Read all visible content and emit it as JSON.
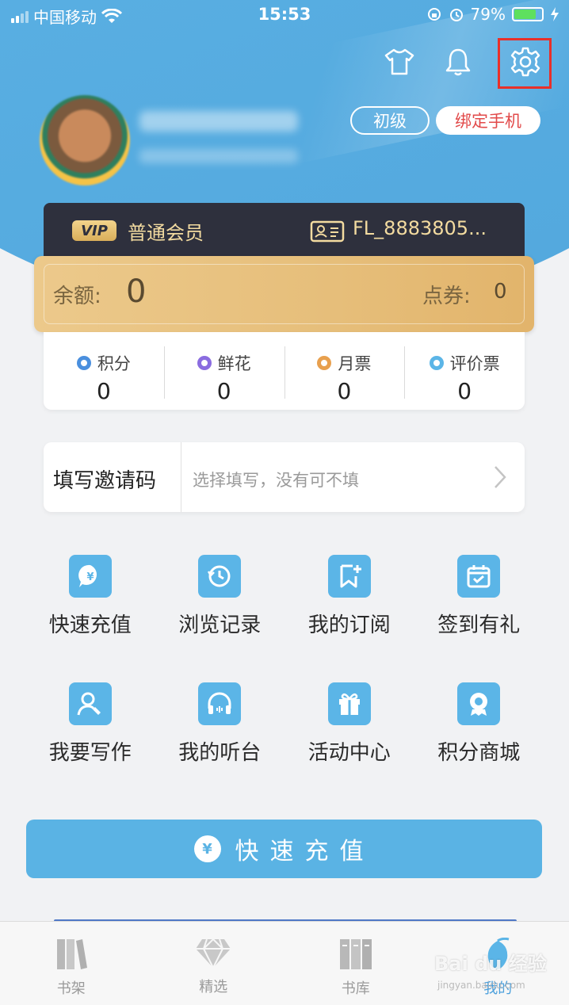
{
  "status_bar": {
    "carrier": "中国移动",
    "time": "15:53",
    "battery": "79%",
    "battery_level": 0.79
  },
  "header": {
    "icons": [
      "shirt-icon",
      "bell-icon",
      "gear-icon"
    ],
    "level_label": "初级",
    "bind_phone_label": "绑定手机"
  },
  "vip": {
    "badge": "VIP",
    "level": "普通会员",
    "user_id": "FL_8883805..."
  },
  "balance": {
    "label": "余额:",
    "value": "0",
    "coupon_label": "点券:",
    "coupon_value": "0"
  },
  "stats": [
    {
      "label": "积分",
      "value": "0",
      "color": "#4a8fde"
    },
    {
      "label": "鲜花",
      "value": "0",
      "color": "#8a6ce0"
    },
    {
      "label": "月票",
      "value": "0",
      "color": "#e8a04e"
    },
    {
      "label": "评价票",
      "value": "0",
      "color": "#5bb5e7"
    }
  ],
  "invite": {
    "title": "填写邀请码",
    "placeholder": "选择填写，没有可不填"
  },
  "grid": [
    {
      "label": "快速充值",
      "icon": "recharge-icon"
    },
    {
      "label": "浏览记录",
      "icon": "history-icon"
    },
    {
      "label": "我的订阅",
      "icon": "subscribe-icon"
    },
    {
      "label": "签到有礼",
      "icon": "calendar-icon"
    },
    {
      "label": "我要写作",
      "icon": "writer-icon"
    },
    {
      "label": "我的听台",
      "icon": "headphones-icon"
    },
    {
      "label": "活动中心",
      "icon": "gift-icon"
    },
    {
      "label": "积分商城",
      "icon": "mall-icon"
    }
  ],
  "recharge_button": {
    "label": "快速充值",
    "coin": "¥"
  },
  "tabs": [
    {
      "label": "书架",
      "icon": "bookshelf-icon",
      "active": false
    },
    {
      "label": "精选",
      "icon": "diamond-icon",
      "active": false
    },
    {
      "label": "书库",
      "icon": "library-icon",
      "active": false
    },
    {
      "label": "我的",
      "icon": "profile-icon",
      "active": true
    }
  ],
  "watermark": {
    "text": "Bai du 经验",
    "sub": "jingyan.baidu.com"
  }
}
